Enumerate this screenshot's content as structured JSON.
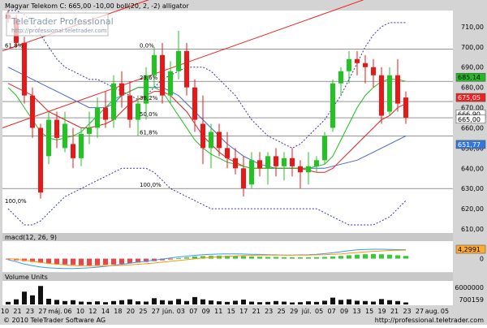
{
  "header": {
    "title": "Magyar Telekom  C: 665,00 -10,00 boll(20, 2, -2) alligator",
    "watermark_brand": "TeleTrader Professional",
    "watermark_url": "http://professional.teletrader.com"
  },
  "footer": {
    "copyright": "© 2010 TeleTrader Software AG",
    "url": "http://professional.teletrader.com"
  },
  "colors": {
    "up": "#22c422",
    "down": "#e81818",
    "channel": "#ee2222",
    "boll": "#3333aa",
    "ma_green": "#22bb22",
    "ma_red": "#dd2222",
    "ma_blue": "#4466cc",
    "panel_bg": "#c8c8c8"
  },
  "chart_data": [
    {
      "type": "candlestick",
      "title": "Magyar Telekom  C: 665,00 -10,00 boll(20, 2, -2) alligator",
      "ylim": [
        608,
        718
      ],
      "yticks": [
        610,
        620,
        630,
        640,
        650,
        660,
        670,
        680,
        690,
        700,
        710
      ],
      "ytick_labels": [
        "610,00",
        "620,00",
        "630,00",
        "640,00",
        "650,00",
        "660,00",
        "670,00",
        "680,00",
        "690,00",
        "700,00",
        "710,00"
      ],
      "x_labels": [
        "10",
        "21",
        "23",
        "27",
        "máj.",
        "06",
        "10",
        "12",
        "14",
        "18",
        "20",
        "25",
        "27",
        "jún.",
        "03",
        "07",
        "09",
        "11",
        "15",
        "17",
        "21",
        "23",
        "25",
        "29",
        "júl.",
        "05",
        "07",
        "09",
        "13",
        "15",
        "19",
        "21",
        "23",
        "27",
        "aug.",
        "05"
      ],
      "candles": [
        {
          "o": 716,
          "h": 718,
          "l": 712,
          "c": 714
        },
        {
          "o": 714,
          "h": 716,
          "l": 700,
          "c": 702
        },
        {
          "o": 702,
          "h": 705,
          "l": 672,
          "c": 676
        },
        {
          "o": 676,
          "h": 680,
          "l": 655,
          "c": 660
        },
        {
          "o": 660,
          "h": 662,
          "l": 625,
          "c": 628
        },
        {
          "o": 646,
          "h": 668,
          "l": 642,
          "c": 664
        },
        {
          "o": 664,
          "h": 668,
          "l": 650,
          "c": 655
        },
        {
          "o": 650,
          "h": 668,
          "l": 648,
          "c": 662
        },
        {
          "o": 652,
          "h": 660,
          "l": 640,
          "c": 645
        },
        {
          "o": 645,
          "h": 660,
          "l": 641,
          "c": 657
        },
        {
          "o": 657,
          "h": 668,
          "l": 652,
          "c": 660
        },
        {
          "o": 660,
          "h": 675,
          "l": 655,
          "c": 670
        },
        {
          "o": 670,
          "h": 678,
          "l": 660,
          "c": 664
        },
        {
          "o": 664,
          "h": 686,
          "l": 660,
          "c": 682
        },
        {
          "o": 682,
          "h": 688,
          "l": 670,
          "c": 676
        },
        {
          "o": 676,
          "h": 683,
          "l": 660,
          "c": 664
        },
        {
          "o": 664,
          "h": 676,
          "l": 656,
          "c": 672
        },
        {
          "o": 672,
          "h": 690,
          "l": 664,
          "c": 686
        },
        {
          "o": 686,
          "h": 700,
          "l": 680,
          "c": 696
        },
        {
          "o": 696,
          "h": 702,
          "l": 672,
          "c": 676
        },
        {
          "o": 676,
          "h": 693,
          "l": 672,
          "c": 688
        },
        {
          "o": 688,
          "h": 708,
          "l": 684,
          "c": 698
        },
        {
          "o": 698,
          "h": 702,
          "l": 676,
          "c": 680
        },
        {
          "o": 680,
          "h": 684,
          "l": 658,
          "c": 664
        },
        {
          "o": 662,
          "h": 676,
          "l": 642,
          "c": 650
        },
        {
          "o": 650,
          "h": 662,
          "l": 640,
          "c": 658
        },
        {
          "o": 658,
          "h": 662,
          "l": 646,
          "c": 650
        },
        {
          "o": 650,
          "h": 658,
          "l": 640,
          "c": 645
        },
        {
          "o": 645,
          "h": 650,
          "l": 637,
          "c": 640
        },
        {
          "o": 640,
          "h": 646,
          "l": 626,
          "c": 630
        },
        {
          "o": 632,
          "h": 648,
          "l": 630,
          "c": 644
        },
        {
          "o": 644,
          "h": 648,
          "l": 636,
          "c": 640
        },
        {
          "o": 640,
          "h": 648,
          "l": 632,
          "c": 646
        },
        {
          "o": 646,
          "h": 650,
          "l": 636,
          "c": 641
        },
        {
          "o": 641,
          "h": 648,
          "l": 634,
          "c": 645
        },
        {
          "o": 645,
          "h": 650,
          "l": 636,
          "c": 641
        },
        {
          "o": 641,
          "h": 644,
          "l": 630,
          "c": 638
        },
        {
          "o": 638,
          "h": 648,
          "l": 632,
          "c": 641
        },
        {
          "o": 641,
          "h": 646,
          "l": 638,
          "c": 644
        },
        {
          "o": 644,
          "h": 658,
          "l": 642,
          "c": 656
        },
        {
          "o": 660,
          "h": 684,
          "l": 658,
          "c": 682
        },
        {
          "o": 682,
          "h": 690,
          "l": 676,
          "c": 688
        },
        {
          "o": 688,
          "h": 698,
          "l": 682,
          "c": 694
        },
        {
          "o": 694,
          "h": 698,
          "l": 686,
          "c": 692
        },
        {
          "o": 692,
          "h": 696,
          "l": 682,
          "c": 690
        },
        {
          "o": 690,
          "h": 694,
          "l": 680,
          "c": 686
        },
        {
          "o": 686,
          "h": 690,
          "l": 662,
          "c": 666
        },
        {
          "o": 668,
          "h": 690,
          "l": 666,
          "c": 686
        },
        {
          "o": 686,
          "h": 694,
          "l": 668,
          "c": 672
        },
        {
          "o": 675,
          "h": 678,
          "l": 662,
          "c": 665
        }
      ],
      "overlays": {
        "bb_upper": [
          718,
          718,
          716,
          712,
          706,
          700,
          694,
          690,
          688,
          686,
          684,
          684,
          682,
          680,
          678,
          676,
          674,
          676,
          680,
          684,
          686,
          688,
          690,
          690,
          690,
          688,
          684,
          680,
          676,
          670,
          664,
          660,
          656,
          654,
          652,
          650,
          652,
          656,
          660,
          664,
          670,
          676,
          684,
          692,
          700,
          706,
          710,
          712,
          712,
          712
        ],
        "bb_lower": [
          620,
          616,
          612,
          612,
          614,
          618,
          622,
          626,
          628,
          630,
          632,
          634,
          636,
          638,
          640,
          640,
          640,
          640,
          638,
          634,
          630,
          628,
          626,
          624,
          622,
          620,
          620,
          620,
          620,
          620,
          620,
          620,
          620,
          620,
          620,
          620,
          620,
          620,
          620,
          618,
          616,
          614,
          612,
          612,
          612,
          612,
          614,
          616,
          620,
          624
        ],
        "alligator_jaw": [
          690,
          688,
          686,
          684,
          682,
          680,
          678,
          676,
          674,
          672,
          670,
          670,
          670,
          672,
          676,
          678,
          680,
          680,
          680,
          680,
          678,
          676,
          672,
          668,
          664,
          660,
          656,
          652,
          649,
          646,
          644,
          642,
          641,
          640,
          640,
          640,
          640,
          640,
          640,
          640,
          641,
          642,
          643,
          644,
          646,
          648,
          650,
          652,
          654,
          656
        ],
        "alligator_teeth": [
          682,
          680,
          678,
          676,
          672,
          668,
          666,
          664,
          662,
          660,
          660,
          661,
          662,
          664,
          668,
          672,
          674,
          676,
          678,
          678,
          676,
          672,
          668,
          662,
          656,
          652,
          648,
          645,
          643,
          641,
          640,
          640,
          640,
          640,
          640,
          640,
          640,
          639,
          638,
          638,
          640,
          644,
          648,
          652,
          656,
          660,
          664,
          666,
          670,
          672
        ],
        "alligator_lips": [
          680,
          676,
          670,
          664,
          658,
          655,
          654,
          655,
          656,
          658,
          662,
          666,
          670,
          674,
          676,
          678,
          680,
          680,
          680,
          678,
          672,
          666,
          660,
          654,
          650,
          647,
          645,
          643,
          642,
          641,
          640,
          640,
          640,
          640,
          640,
          640,
          640,
          640,
          641,
          642,
          646,
          654,
          662,
          670,
          676,
          680,
          683,
          684,
          684,
          683
        ]
      },
      "channel": {
        "lower": {
          "y_start": 660,
          "y_end": 739
        },
        "upper": {
          "y_start": 698,
          "y_end": 776
        }
      },
      "fibonacci": [
        {
          "label": "0,0%",
          "value": 699
        },
        {
          "label": "23,6%",
          "value": 683
        },
        {
          "label": "38,2%",
          "value": 673
        },
        {
          "label": "50,0%",
          "value": 665
        },
        {
          "label": "61,8%",
          "value": 656
        },
        {
          "label": "100,0%",
          "value": 630
        }
      ],
      "fib_outer_labels": [
        {
          "label": "61,8%",
          "value": 699
        },
        {
          "label": "100,0%",
          "value": 622
        }
      ],
      "h_lines": [
        699,
        683,
        673,
        665,
        656,
        630
      ],
      "right_tags": [
        {
          "label": "685,14",
          "value": 685,
          "bg": "#22bb22",
          "fg": "#000000"
        },
        {
          "label": "675,05",
          "value": 675,
          "bg": "#ee2222",
          "fg": "#ffffff"
        },
        {
          "label": "666,90",
          "value": 666.9,
          "bg": "#ffffff",
          "fg": "#000000"
        },
        {
          "label": "665,00",
          "value": 664.3,
          "bg": "#ffffff",
          "fg": "#000000"
        },
        {
          "label": "651,77",
          "value": 651.8,
          "bg": "#3377dd",
          "fg": "#ffffff"
        }
      ]
    },
    {
      "type": "macd",
      "label": "macd(12, 26, 9)",
      "ylim": [
        -6,
        8
      ],
      "yticks": [
        0
      ],
      "ytick_labels": [
        "0"
      ],
      "value_tag": "4,2991",
      "histogram": [
        -0.4,
        -0.8,
        -1.2,
        -1.6,
        -2.0,
        -2.4,
        -2.6,
        -2.8,
        -3.0,
        -3.2,
        -3.3,
        -3.2,
        -3.0,
        -2.8,
        -2.5,
        -2.2,
        -1.9,
        -1.6,
        -1.2,
        -0.8,
        -0.4,
        0.2,
        0.6,
        1.0,
        1.2,
        1.3,
        1.4,
        1.4,
        1.3,
        1.2,
        1.0,
        0.9,
        0.8,
        0.8,
        0.7,
        0.6,
        0.6,
        0.6,
        0.7,
        0.8,
        1.0,
        1.3,
        1.6,
        1.9,
        2.1,
        2.2,
        2.1,
        1.9,
        1.6,
        1.3
      ],
      "macd_line": [
        -0.5,
        -1.5,
        -2.6,
        -3.4,
        -4.0,
        -4.4,
        -4.6,
        -4.7,
        -4.7,
        -4.6,
        -4.4,
        -4.1,
        -3.7,
        -3.2,
        -2.7,
        -2.2,
        -1.7,
        -1.2,
        -0.7,
        -0.2,
        0.3,
        0.8,
        1.2,
        1.6,
        1.9,
        2.1,
        2.2,
        2.3,
        2.3,
        2.2,
        2.1,
        2.0,
        1.9,
        1.8,
        1.7,
        1.7,
        1.8,
        1.9,
        2.1,
        2.4,
        2.8,
        3.3,
        3.8,
        4.2,
        4.4,
        4.5,
        4.5,
        4.4,
        4.3,
        4.3
      ],
      "signal_line": [
        0.0,
        -0.3,
        -0.8,
        -1.3,
        -1.8,
        -2.3,
        -2.7,
        -3.0,
        -3.3,
        -3.5,
        -3.6,
        -3.6,
        -3.5,
        -3.4,
        -3.2,
        -3.0,
        -2.7,
        -2.4,
        -2.1,
        -1.7,
        -1.3,
        -0.9,
        -0.5,
        -0.1,
        0.3,
        0.6,
        0.9,
        1.1,
        1.3,
        1.5,
        1.6,
        1.7,
        1.7,
        1.7,
        1.7,
        1.7,
        1.7,
        1.7,
        1.8,
        1.9,
        2.1,
        2.3,
        2.6,
        2.9,
        3.2,
        3.5,
        3.7,
        3.9,
        4.0,
        4.1
      ]
    },
    {
      "type": "bar",
      "label": "Volume Units",
      "ylim": [
        0,
        8000000
      ],
      "yticks": [
        6000000
      ],
      "ytick_labels": [
        "6000000"
      ],
      "value_tag": "700159",
      "values": [
        900000,
        1800000,
        4500000,
        3200000,
        6500000,
        2000000,
        1600000,
        1200000,
        1500000,
        1000000,
        900000,
        1100000,
        800000,
        1200000,
        1500000,
        1800000,
        1100000,
        1000000,
        2200000,
        1500000,
        1300000,
        1900000,
        1200000,
        2600000,
        1800000,
        1400000,
        1100000,
        900000,
        1300000,
        1700000,
        1000000,
        800000,
        900000,
        1200000,
        1000000,
        700000,
        800000,
        1100000,
        900000,
        1300000,
        2400000,
        1600000,
        1800000,
        1300000,
        1200000,
        1000000,
        1900000,
        1500000,
        1200000,
        700159
      ]
    }
  ]
}
